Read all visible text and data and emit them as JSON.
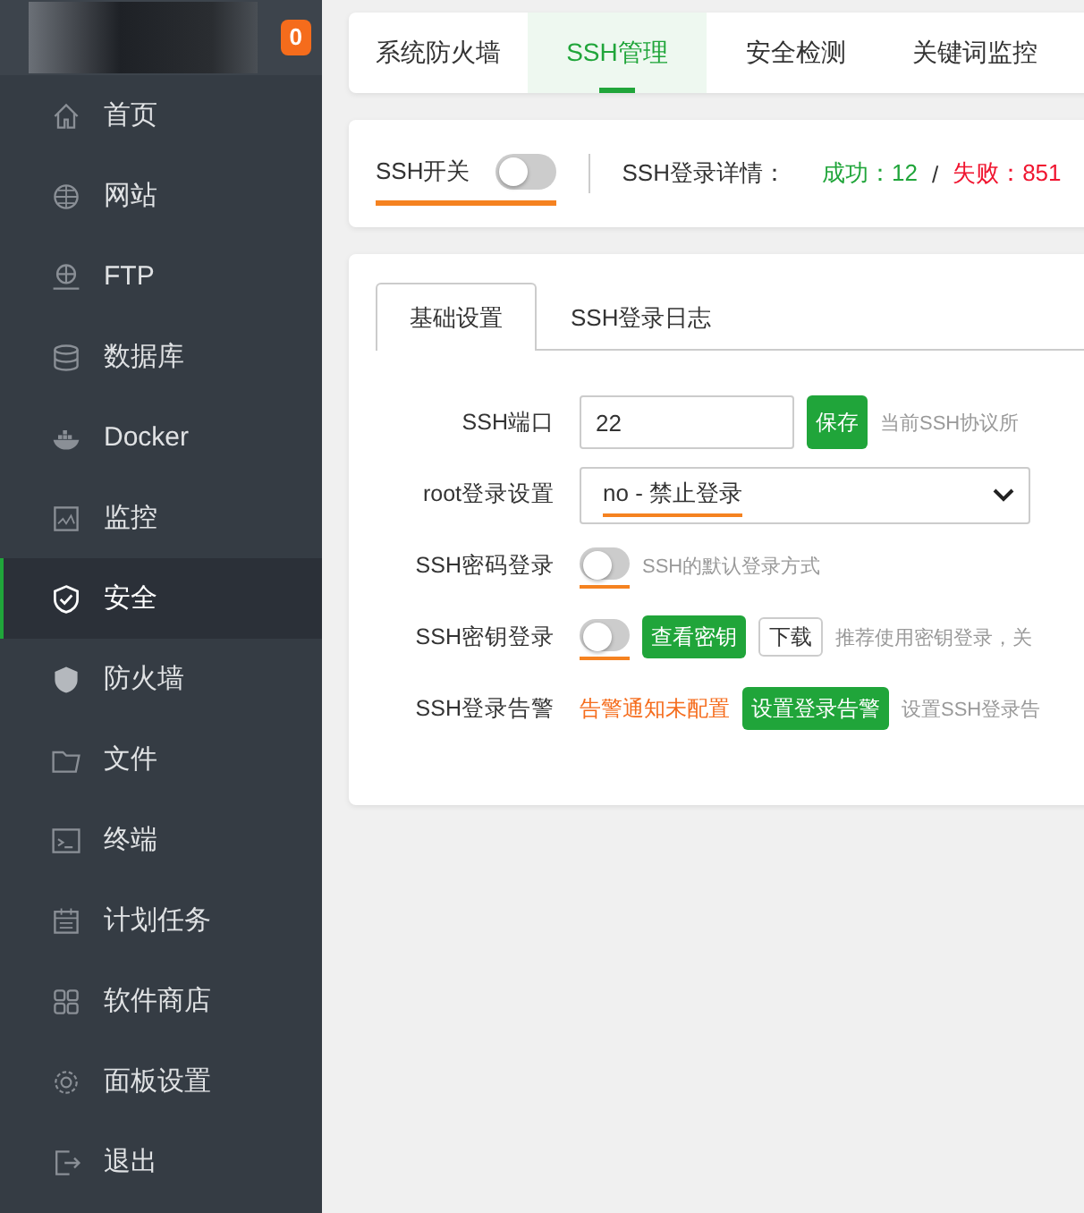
{
  "sidebar": {
    "badge": "0",
    "items": [
      {
        "label": "首页",
        "selected": false
      },
      {
        "label": "网站",
        "selected": false
      },
      {
        "label": "FTP",
        "selected": false
      },
      {
        "label": "数据库",
        "selected": false
      },
      {
        "label": "Docker",
        "selected": false
      },
      {
        "label": "监控",
        "selected": false
      },
      {
        "label": "安全",
        "selected": true
      },
      {
        "label": "防火墙",
        "selected": false
      },
      {
        "label": "文件",
        "selected": false
      },
      {
        "label": "终端",
        "selected": false
      },
      {
        "label": "计划任务",
        "selected": false
      },
      {
        "label": "软件商店",
        "selected": false
      },
      {
        "label": "面板设置",
        "selected": false
      },
      {
        "label": "退出",
        "selected": false
      }
    ]
  },
  "tabs": [
    {
      "label": "系统防火墙",
      "selected": false
    },
    {
      "label": "SSH管理",
      "selected": true
    },
    {
      "label": "安全检测",
      "selected": false
    },
    {
      "label": "关键词监控",
      "selected": false
    }
  ],
  "ssh_status": {
    "label": "SSH开关",
    "on": false,
    "marked": true,
    "details_label": "SSH登录详情：",
    "success": "成功：12",
    "separator": "/",
    "failure": "失败：851"
  },
  "panel": {
    "tabs": [
      {
        "label": "基础设置",
        "selected": true
      },
      {
        "label": "SSH登录日志",
        "selected": false
      }
    ],
    "rows": [
      {
        "kind": "port",
        "label": "SSH端口",
        "value": "22",
        "button": "保存",
        "hint": "当前SSH协议所"
      },
      {
        "kind": "select",
        "label": "root登录设置",
        "value": "no - 禁止登录",
        "marked": true
      },
      {
        "kind": "toggle",
        "label": "SSH密码登录",
        "on": false,
        "marked": true,
        "hint": "SSH的默认登录方式"
      },
      {
        "kind": "toggle",
        "label": "SSH密钥登录",
        "on": false,
        "marked": true,
        "buttons": [
          {
            "label": "查看密钥",
            "primary": true
          },
          {
            "label": "下载",
            "primary": false
          }
        ],
        "hint": "推荐使用密钥登录，关"
      },
      {
        "kind": "alert",
        "label": "SSH登录告警",
        "status": "告警通知未配置",
        "button": "设置登录告警",
        "hint": "设置SSH登录告"
      }
    ]
  }
}
